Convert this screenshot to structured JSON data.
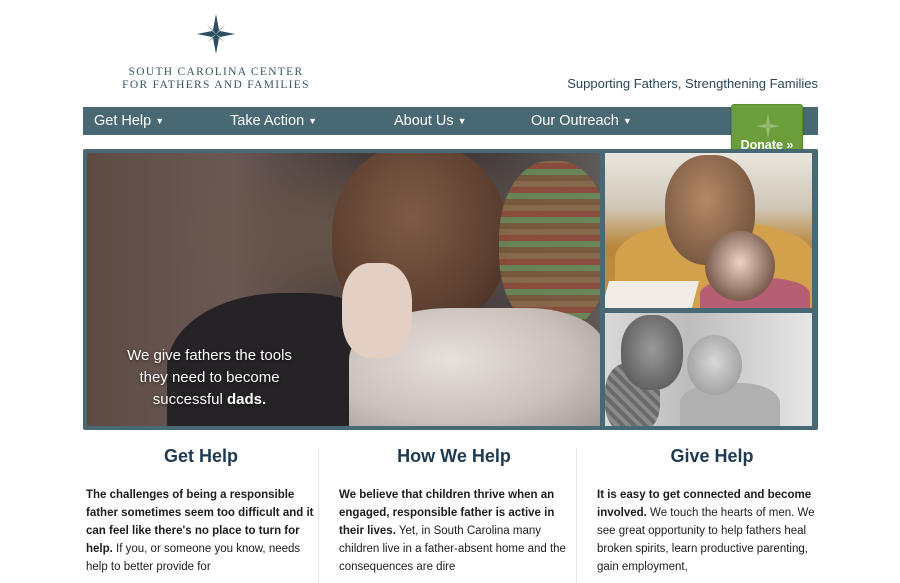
{
  "logo": {
    "line1": "South Carolina Center",
    "line2": "for Fathers and Families"
  },
  "tagline": "Supporting Fathers, Strengthening Families",
  "nav": {
    "items": [
      {
        "label": "Get Help",
        "icon": "caret-down-icon"
      },
      {
        "label": "Take Action",
        "icon": "caret-down-icon"
      },
      {
        "label": "About Us",
        "icon": "caret-down-icon"
      },
      {
        "label": "Our Outreach",
        "icon": "caret-down-icon"
      }
    ],
    "donate_label": "Donate »"
  },
  "hero": {
    "caption_line1": "We give fathers the tools",
    "caption_line2": "they need to become",
    "caption_line3": "successful",
    "caption_bold": "dads."
  },
  "columns": [
    {
      "title": "Get Help",
      "bold": "The challenges of being a responsible father sometimes seem too difficult and it can feel like there's no place to turn for help.",
      "text": " If you, or someone you know, needs help to better provide for"
    },
    {
      "title": "How We Help",
      "bold": "We believe that children thrive when an engaged, responsible father is active in their lives.",
      "text": " Yet, in South Carolina many children live in a father-absent home and the consequences are dire"
    },
    {
      "title": "Give Help",
      "bold": "It is easy to get connected and become involved.",
      "text": " We touch the hearts of men. We see great opportunity to help fathers heal broken spirits, learn productive parenting, gain employment,"
    }
  ],
  "colors": {
    "nav_bg": "#486873",
    "donate_bg": "#6b9d3a",
    "heading": "#1d3a52",
    "tagline": "#2a4759"
  }
}
